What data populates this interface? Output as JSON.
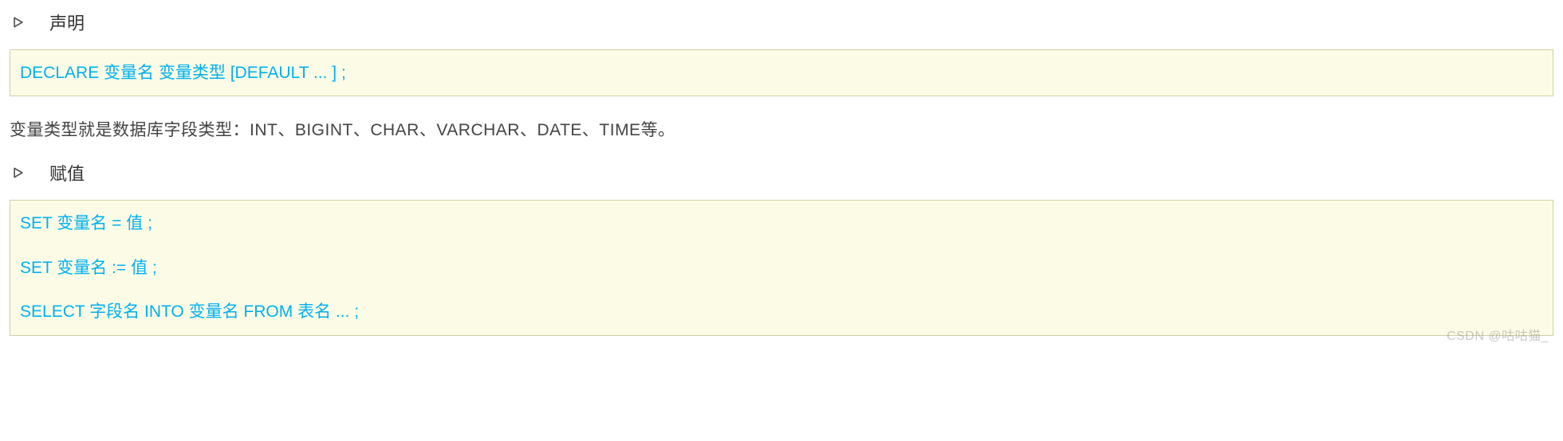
{
  "section1": {
    "label": "声明",
    "code_lines": [
      "DECLARE 变量名 变量类型 [DEFAULT ... ] ;"
    ]
  },
  "paragraph1": "变量类型就是数据库字段类型：INT、BIGINT、CHAR、VARCHAR、DATE、TIME等。",
  "section2": {
    "label": "赋值",
    "code_lines": [
      "SET  变量名 = 值 ;",
      "SET  变量名 := 值 ;",
      "SELECT  字段名  INTO  变量名  FROM  表名 ... ;"
    ]
  },
  "watermark": "CSDN @咕咕猫_"
}
